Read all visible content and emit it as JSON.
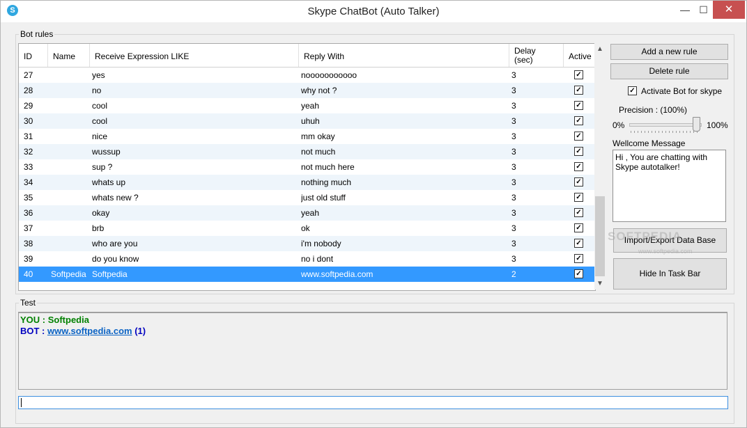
{
  "window": {
    "title": "Skype ChatBot (Auto Talker)",
    "icon": "skype-icon",
    "minimize": "—",
    "maximize": "☐",
    "close": "✕"
  },
  "bot_rules": {
    "legend": "Bot rules",
    "columns": [
      "ID",
      "Name",
      "Receive Expression LIKE",
      "Reply With",
      "Delay\n(sec)",
      "Active"
    ],
    "rows": [
      {
        "id": "27",
        "name": "",
        "receive": "yes",
        "reply": "nooooooooooo",
        "delay": "3",
        "active": true
      },
      {
        "id": "28",
        "name": "",
        "receive": "no",
        "reply": "why not ?",
        "delay": "3",
        "active": true
      },
      {
        "id": "29",
        "name": "",
        "receive": "cool",
        "reply": "yeah",
        "delay": "3",
        "active": true
      },
      {
        "id": "30",
        "name": "",
        "receive": "cool",
        "reply": "uhuh",
        "delay": "3",
        "active": true
      },
      {
        "id": "31",
        "name": "",
        "receive": "nice",
        "reply": "mm okay",
        "delay": "3",
        "active": true
      },
      {
        "id": "32",
        "name": "",
        "receive": "wussup",
        "reply": "not much",
        "delay": "3",
        "active": true
      },
      {
        "id": "33",
        "name": "",
        "receive": "sup ?",
        "reply": "not much here",
        "delay": "3",
        "active": true
      },
      {
        "id": "34",
        "name": "",
        "receive": "whats up",
        "reply": "nothing much",
        "delay": "3",
        "active": true
      },
      {
        "id": "35",
        "name": "",
        "receive": "whats new ?",
        "reply": "just old stuff",
        "delay": "3",
        "active": true
      },
      {
        "id": "36",
        "name": "",
        "receive": "okay",
        "reply": "yeah",
        "delay": "3",
        "active": true
      },
      {
        "id": "37",
        "name": "",
        "receive": "brb",
        "reply": "ok",
        "delay": "3",
        "active": true
      },
      {
        "id": "38",
        "name": "",
        "receive": "who are you",
        "reply": "i'm nobody",
        "delay": "3",
        "active": true
      },
      {
        "id": "39",
        "name": "",
        "receive": "do you know",
        "reply": "no i dont",
        "delay": "3",
        "active": true
      },
      {
        "id": "40",
        "name": "Softpedia",
        "receive": "Softpedia",
        "reply": "www.softpedia.com",
        "delay": "2",
        "active": true,
        "selected": true
      }
    ]
  },
  "side": {
    "add_rule": "Add a new rule",
    "delete_rule": "Delete rule",
    "activate_label": "Activate Bot for skype",
    "activate_checked": true,
    "precision_label": "Precision : (100%)",
    "precision_value": 1.0,
    "min_label": "0%",
    "max_label": "100%",
    "welcome_label": "Wellcome Message",
    "welcome_text": "Hi , You are chatting with Skype autotalker!",
    "import_export": "Import/Export Data Base",
    "hide_taskbar": "Hide In Task Bar"
  },
  "watermark": {
    "text": "SOFTPEDIA",
    "sub": "www.softpedia.com"
  },
  "test": {
    "legend": "Test",
    "you_prefix": "YOU : ",
    "you_text": "Softpedia",
    "bot_prefix": "BOT : ",
    "bot_link": "www.softpedia.com",
    "bot_suffix": " (1)",
    "input_value": ""
  },
  "colors": {
    "selection": "#3399ff",
    "you": "#008000",
    "bot": "#0000c0",
    "close": "#c75050"
  }
}
